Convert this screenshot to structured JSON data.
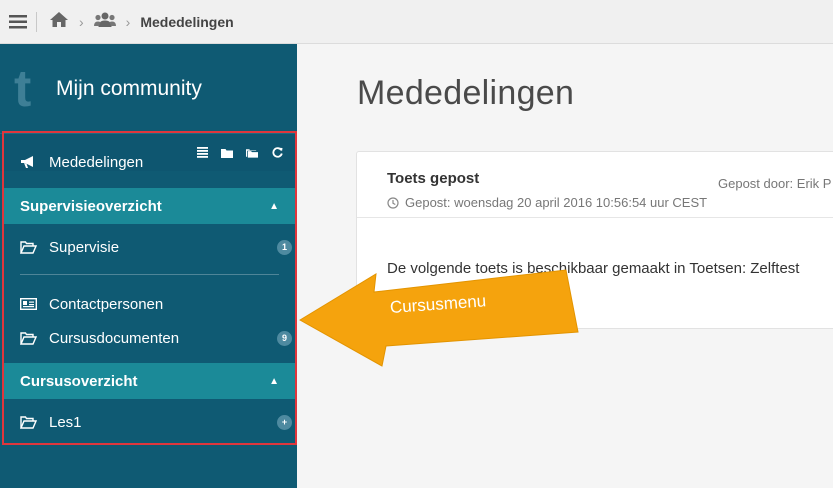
{
  "topbar": {
    "breadcrumb_current": "Mededelingen"
  },
  "sidebar": {
    "brand_logo": "t",
    "brand_title": "Mijn community",
    "items": [
      {
        "label": "Mededelingen"
      },
      {
        "label": "Supervisie",
        "badge": "1"
      },
      {
        "label": "Contactpersonen"
      },
      {
        "label": "Cursusdocumenten",
        "badge": "9"
      },
      {
        "label": "Les1",
        "badge": "+"
      }
    ],
    "sections": [
      {
        "label": "Supervisieoverzicht"
      },
      {
        "label": "Cursusoverzicht"
      }
    ]
  },
  "main": {
    "page_title": "Mededelingen",
    "announcement": {
      "title": "Toets gepost",
      "posted": "Gepost: woensdag 20 april 2016 10:56:54 uur CEST",
      "author": "Gepost door: Erik P",
      "body": "De volgende toets is beschikbaar gemaakt in Toetsen: Zelftest"
    }
  },
  "callout": {
    "label": "Cursusmenu",
    "color": "#f5a30d"
  },
  "colors": {
    "sidebar": "#0f5a73",
    "section": "#1b8a98",
    "highlight_border": "#e0363c"
  }
}
